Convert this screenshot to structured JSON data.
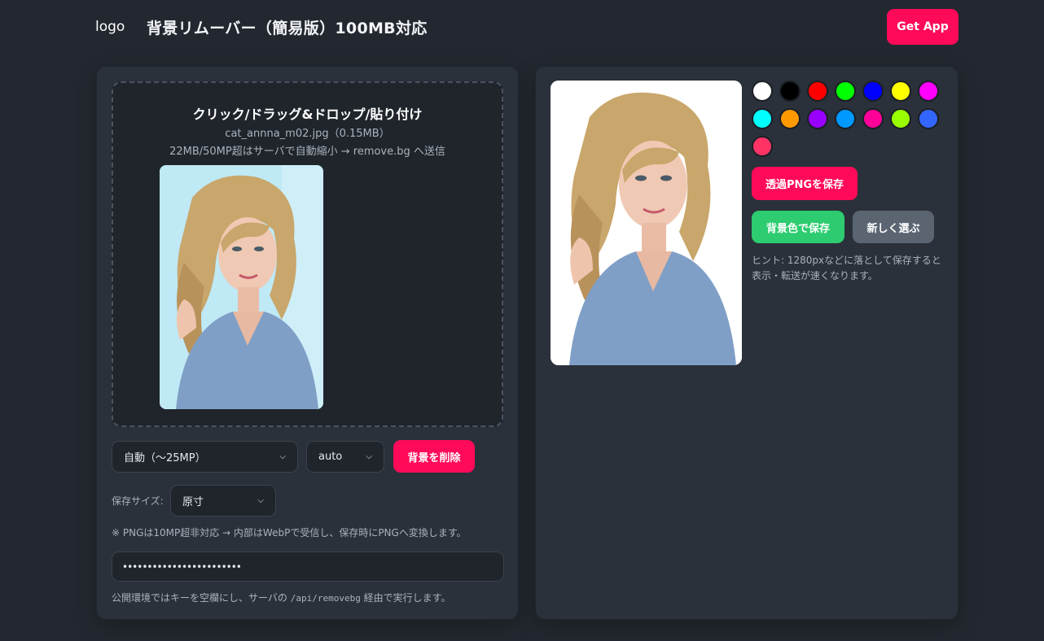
{
  "header": {
    "logo_alt": "logo",
    "title": "背景リムーバー（簡易版）100MB対応",
    "get_app": "Get App"
  },
  "left": {
    "drop_title": "クリック/ドラッグ&ドロップ/貼り付け",
    "file_info": "cat_annna_m02.jpg（0.15MB）",
    "drop_note": "22MB/50MP超はサーバで自動縮小 → remove.bg へ送信",
    "mode_select": "自動（〜25MP）",
    "format_select": "auto",
    "remove_button": "背景を削除",
    "save_size_label": "保存サイズ:",
    "save_size_select": "原寸",
    "note1": "※ PNGは10MP超非対応 → 内部はWebPで受信し、保存時にPNGへ変換します。",
    "api_key_masked": "••••••••••••••••••••••••",
    "note2_prefix": "公開環境ではキーを空欄にし、サーバの",
    "note2_code": "/api/removebg",
    "note2_suffix": "経由で実行します。"
  },
  "right": {
    "swatches": [
      "#ffffff",
      "#000000",
      "#ff0000",
      "#00ff00",
      "#0000ff",
      "#ffff00",
      "#ff00ff",
      "#00ffff",
      "#ff9900",
      "#9900ff",
      "#0099ff",
      "#ff0099",
      "#99ff00",
      "#3366ff",
      "#ff3366"
    ],
    "save_png": "透過PNGを保存",
    "save_bg": "背景色で保存",
    "choose_new": "新しく選ぶ",
    "hint": "ヒント: 1280pxなどに落として保存すると表示・転送が速くなります。"
  }
}
